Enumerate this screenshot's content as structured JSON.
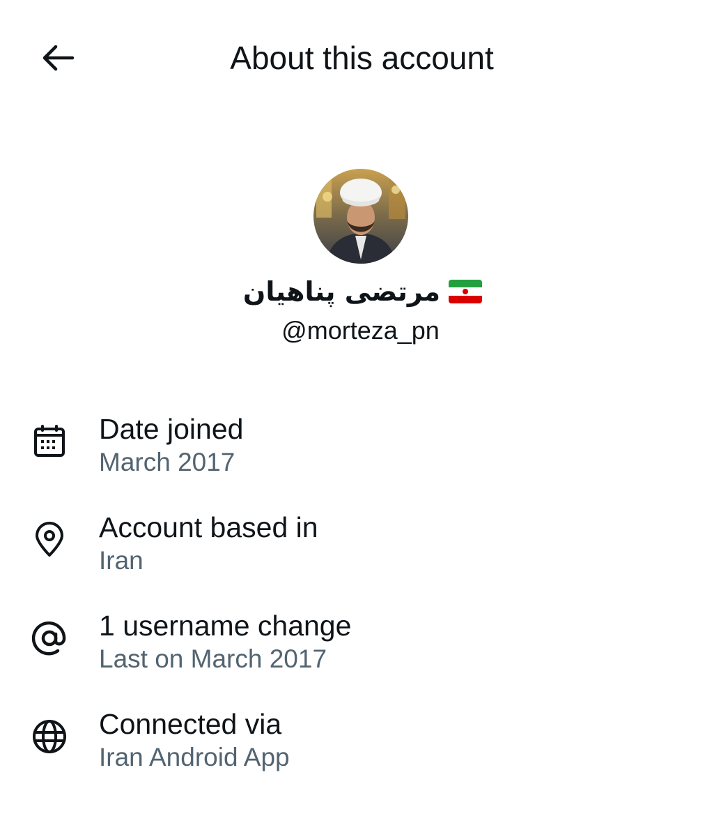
{
  "header": {
    "title": "About this account",
    "back_icon": "arrow-left-icon"
  },
  "profile": {
    "display_name": "مرتضی پناهیان",
    "flag_icon": "iran-flag-icon",
    "flag_colors": [
      "#239f40",
      "#ffffff",
      "#da0000"
    ],
    "handle": "@morteza_pn"
  },
  "info": [
    {
      "icon": "calendar-icon",
      "label": "Date joined",
      "value": "March 2017"
    },
    {
      "icon": "location-pin-icon",
      "label": "Account based in",
      "value": "Iran"
    },
    {
      "icon": "at-sign-icon",
      "label": "1 username change",
      "value": "Last on March 2017"
    },
    {
      "icon": "globe-icon",
      "label": "Connected via",
      "value": "Iran Android App"
    }
  ],
  "colors": {
    "primary_text": "#0f1419",
    "secondary_text": "#536471",
    "background": "#ffffff"
  }
}
